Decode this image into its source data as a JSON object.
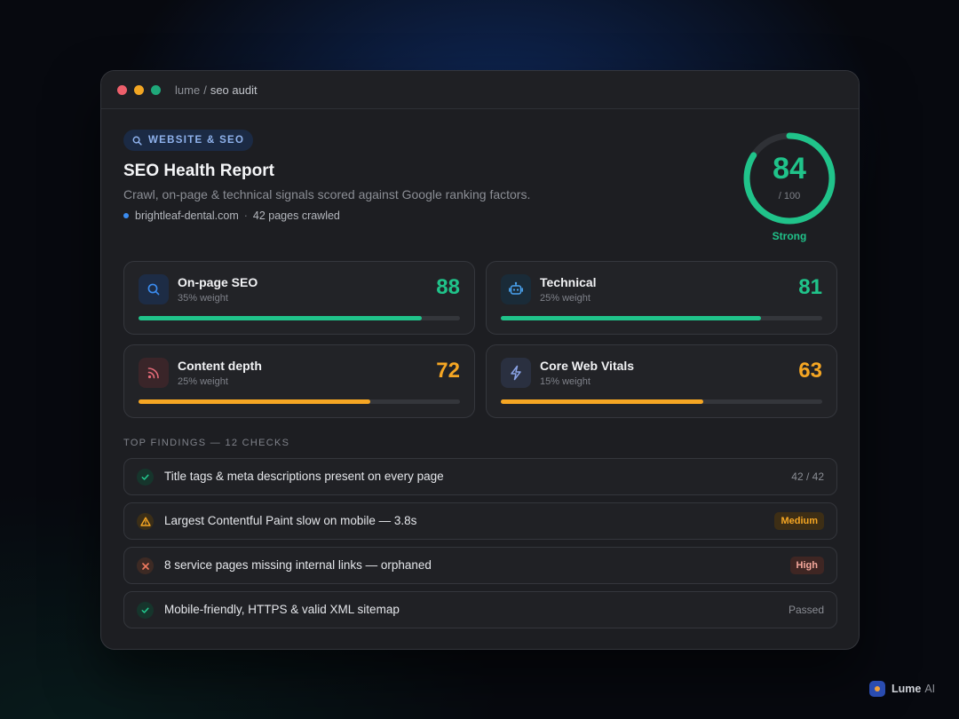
{
  "window": {
    "breadcrumb_root": "lume",
    "breadcrumb_sep": "/",
    "breadcrumb_current": "seo audit",
    "traffic_lights": [
      "#ed5f6b",
      "#f2a623",
      "#1fa87a"
    ]
  },
  "header": {
    "tag": "WEBSITE & SEO",
    "title": "SEO Health Report",
    "subtitle": "Crawl, on-page & technical signals scored against Google ranking factors.",
    "domain": "brightleaf-dental.com",
    "separator": "·",
    "pages": "42 pages crawled"
  },
  "overall": {
    "score": "84",
    "out_of": "/ 100",
    "fraction": 0.84,
    "label": "Strong",
    "color": "#20c38a"
  },
  "categories": [
    {
      "name": "On-page SEO",
      "weight": "35% weight",
      "score": "88",
      "fraction": 0.88,
      "color": "#20c38a",
      "icon": "search-icon",
      "icon_color": "#3b8cf0",
      "icon_bg": "#1d2c45"
    },
    {
      "name": "Technical",
      "weight": "25% weight",
      "score": "81",
      "fraction": 0.81,
      "color": "#20c38a",
      "icon": "robot-icon",
      "icon_color": "#4aa3f0",
      "icon_bg": "#1a2b38"
    },
    {
      "name": "Content depth",
      "weight": "25% weight",
      "score": "72",
      "fraction": 0.72,
      "color": "#f5a623",
      "icon": "rss-icon",
      "icon_color": "#e46a78",
      "icon_bg": "#3a2529"
    },
    {
      "name": "Core Web Vitals",
      "weight": "15% weight",
      "score": "63",
      "fraction": 0.63,
      "color": "#f5a623",
      "icon": "lightning-icon",
      "icon_color": "#8aa3e6",
      "icon_bg": "#2a3040"
    }
  ],
  "findings": {
    "heading": "TOP FINDINGS — 12 CHECKS",
    "items": [
      {
        "text": "Title tags & meta descriptions present on every page",
        "status": "pass",
        "meta": "42 / 42"
      },
      {
        "text": "Largest Contentful Paint slow on mobile — 3.8s",
        "status": "warning",
        "badge": "Medium"
      },
      {
        "text": "8 service pages missing internal links — orphaned",
        "status": "error",
        "badge": "High"
      },
      {
        "text": "Mobile-friendly, HTTPS & valid XML sitemap",
        "status": "pass",
        "meta": "Passed"
      }
    ]
  },
  "brand": {
    "name": "Lume",
    "suffix": "AI"
  }
}
